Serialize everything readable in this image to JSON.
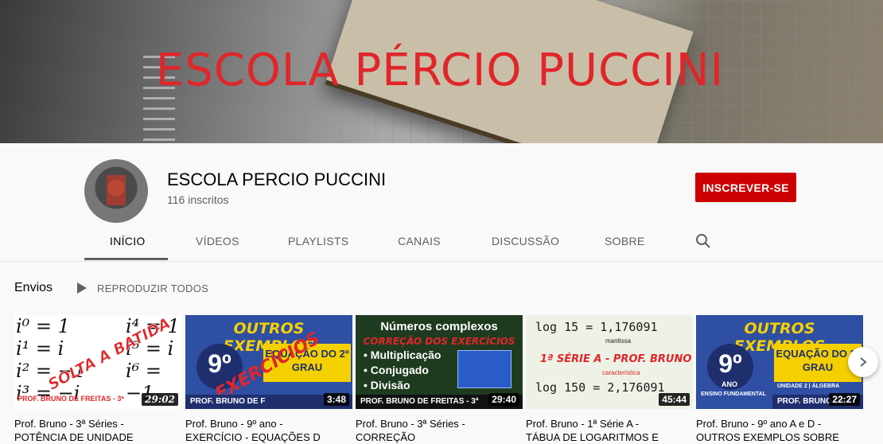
{
  "banner": {
    "title": "ESCOLA PÉRCIO PUCCINI"
  },
  "channel": {
    "name": "ESCOLA PERCIO PUCCINI",
    "subscribers": "116 inscritos",
    "subscribe_label": "INSCREVER-SE"
  },
  "tabs": [
    "INÍCIO",
    "VÍDEOS",
    "PLAYLISTS",
    "CANAIS",
    "DISCUSSÃO",
    "SOBRE"
  ],
  "active_tab": "INÍCIO",
  "section": {
    "title": "Envios",
    "play_all_label": "REPRODUZIR TODOS"
  },
  "videos": [
    {
      "title_line1": "Prof. Bruno - 3ª Séries -",
      "title_line2": "POTÊNCIA DE UNIDADE",
      "duration": "29:02",
      "thumb_text": [
        "SOLTA A BATIDA",
        "PROF. BRUNO DE FREITAS - 3ª"
      ]
    },
    {
      "title_line1": "Prof. Bruno - 9º ano -",
      "title_line2": "EXERCÍCIO - EQUAÇÕES D",
      "duration": "3:48",
      "thumb_text": [
        "OUTROS EXEMPLOS",
        "9º",
        "EQUAÇÃO DO 2º GRAU",
        "EXERCÍCIOS",
        "PROF. BRUNO DE F"
      ]
    },
    {
      "title_line1": "Prof. Bruno - 3ª Séries -",
      "title_line2": "CORREÇÃO",
      "duration": "29:40",
      "thumb_text": [
        "Números complexos",
        "CORREÇÃO DOS EXERCÍCIOS",
        "• Multiplicação",
        "• Conjugado",
        "• Divisão",
        "PROF. BRUNO DE FREITAS - 3ª"
      ]
    },
    {
      "title_line1": "Prof. Bruno - 1ª Série A -",
      "title_line2": "TÁBUA DE LOGARITMOS E",
      "duration": "45:44",
      "thumb_text": [
        "log 15 = 1,176091",
        "1ª SÉRIE A - PROF. BRUNO",
        "log 150 = 2,176091",
        "mantissa",
        "característica"
      ]
    },
    {
      "title_line1": "Prof. Bruno - 9º ano A e D -",
      "title_line2": "OUTROS EXEMPLOS SOBRE",
      "duration": "22:27",
      "thumb_text": [
        "OUTROS EXEMPLOS",
        "9º",
        "ANO",
        "EQUAÇÃO DO 2º GRAU",
        "ENSINO FUNDAMENTAL",
        "UNIDADE 2 | ÁLGEBRA",
        "PROF. BRUNO DE F"
      ]
    }
  ],
  "colors": {
    "accent": "#cc0000",
    "banner_text": "#e0262a",
    "thumb_yellow": "#f5d000",
    "thumb_blue": "#2e4fa3"
  },
  "icons": {
    "search": "search-icon",
    "play": "play-icon",
    "next": "chevron-right-icon"
  }
}
